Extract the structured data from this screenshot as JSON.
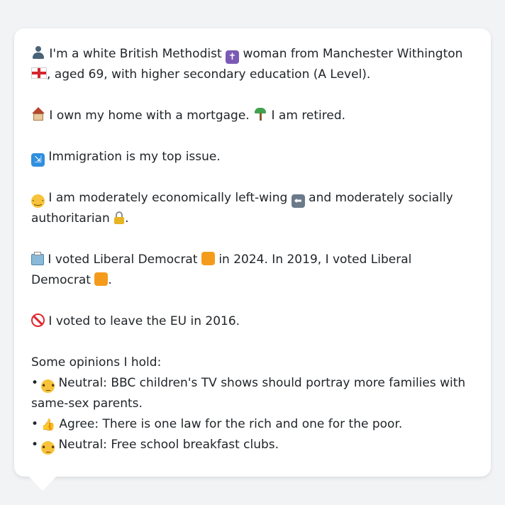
{
  "profile": {
    "identity_line": "I'm a white British Methodist",
    "identity_mid": "woman from Manchester Withington",
    "identity_tail": ", aged 69, with higher secondary education (A Level).",
    "home_text": "I own my home with a mortgage.",
    "work_text": "I am retired.",
    "issue_text": "Immigration is my top issue.",
    "politics_a": "I am moderately economically left-wing",
    "politics_b": "and moderately socially authoritarian",
    "politics_end": ".",
    "vote_a": "I voted Liberal Democrat",
    "vote_b": "in 2024. In 2019, I voted Liberal Democrat",
    "vote_end": ".",
    "eu_text": "I voted to leave the EU in 2016."
  },
  "opinions": {
    "heading": "Some opinions I hold:",
    "items": [
      {
        "stance": "Neutral:",
        "text": "BBC children's TV shows should portray more families with same-sex parents."
      },
      {
        "stance": "Agree:",
        "text": "There is one law for the rich and one for the poor."
      },
      {
        "stance": "Neutral:",
        "text": "Free school breakfast clubs."
      }
    ]
  },
  "icons": {
    "person": "person-silhouette-icon",
    "cross": "latin-cross-icon",
    "flag": "england-flag-icon",
    "house": "house-icon",
    "palm": "palm-tree-icon",
    "immigration": "passport-control-icon",
    "thinking": "thinking-face-icon",
    "left_arrow": "left-arrow-icon",
    "lock": "lock-icon",
    "ballot": "ballot-box-icon",
    "party_square": "orange-square-icon",
    "no_entry": "no-entry-icon",
    "neutral": "neutral-face-icon",
    "thumbs_up": "thumbs-up-icon"
  },
  "colors": {
    "party_orange": "#f59b1b",
    "card_bg": "#ffffff",
    "page_bg": "#f2f3f5",
    "text": "#212529"
  }
}
